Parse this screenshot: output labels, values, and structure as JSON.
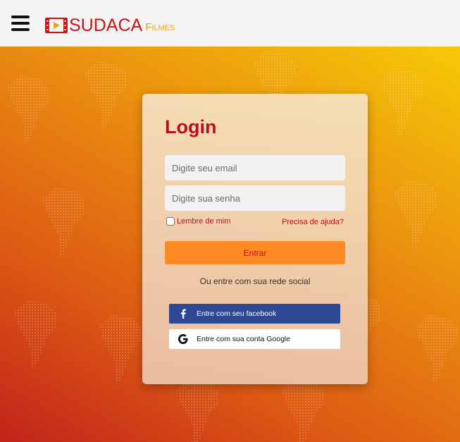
{
  "header": {
    "menu_icon": "hamburger-menu-icon",
    "logo": {
      "main": "SUDACA",
      "sub": "Filmes",
      "icon": "film-play-icon"
    }
  },
  "login": {
    "title": "Login",
    "email_placeholder": "Digite seu email",
    "password_placeholder": "Digite sua senha",
    "remember_label": "Lembre de mim",
    "help_link": "Precisa de ajuda?",
    "submit_label": "Entrar",
    "social_text": "Ou entre com sua rede social",
    "facebook_label": "Entre com seu facebook",
    "google_label": "Entre com sua conta Google"
  },
  "colors": {
    "brand_red": "#b5121b",
    "submit_orange": "#ff8a24",
    "facebook_blue": "#2d4994",
    "logo_gold": "#f0a31e"
  }
}
